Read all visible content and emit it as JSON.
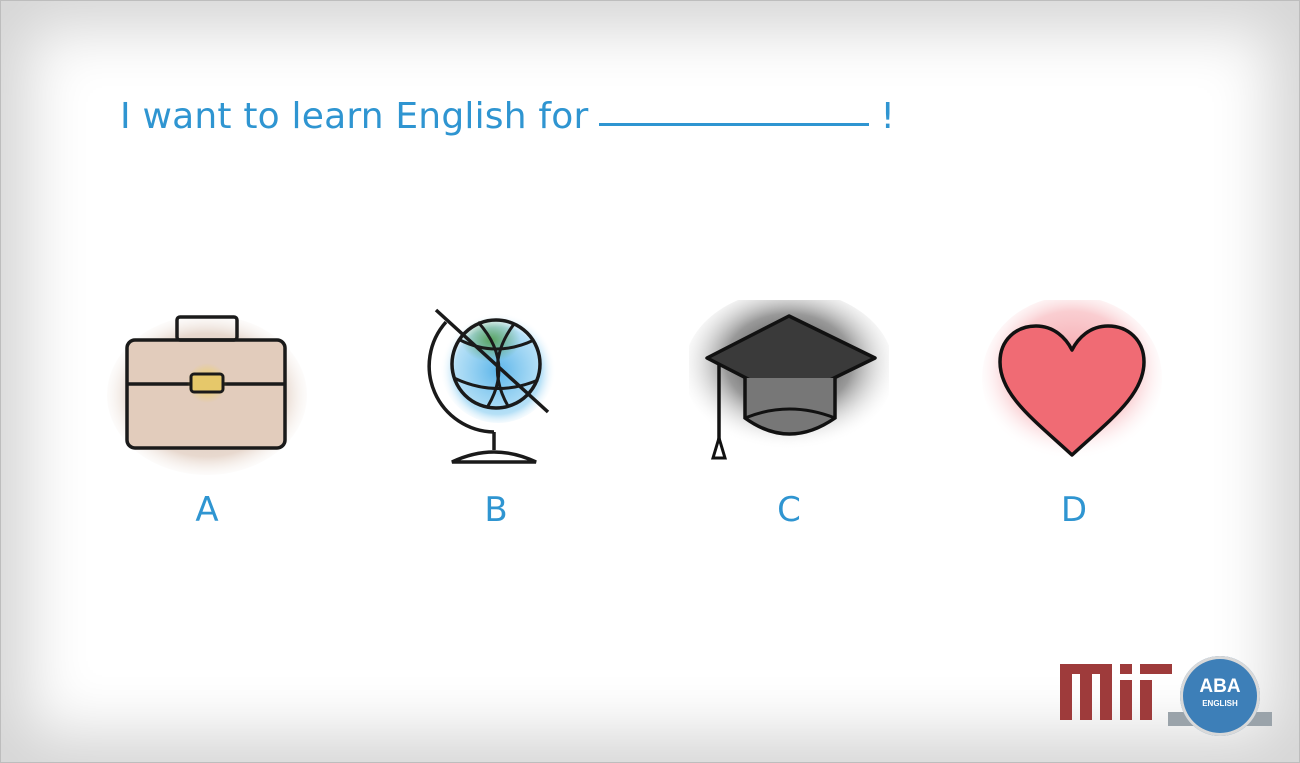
{
  "slide": {
    "question_before": "I want to learn English for",
    "question_after": "!"
  },
  "options": [
    {
      "letter": "A",
      "icon": "briefcase-icon"
    },
    {
      "letter": "B",
      "icon": "globe-icon"
    },
    {
      "letter": "C",
      "icon": "graduation-cap-icon"
    },
    {
      "letter": "D",
      "icon": "heart-icon"
    }
  ],
  "logos": {
    "aba_text": "ABA",
    "aba_sub": "ENGLISH"
  },
  "colors": {
    "accent": "#2f95d1",
    "mit_red": "#9e3b3b",
    "aba_blue": "#3d7fb8"
  }
}
